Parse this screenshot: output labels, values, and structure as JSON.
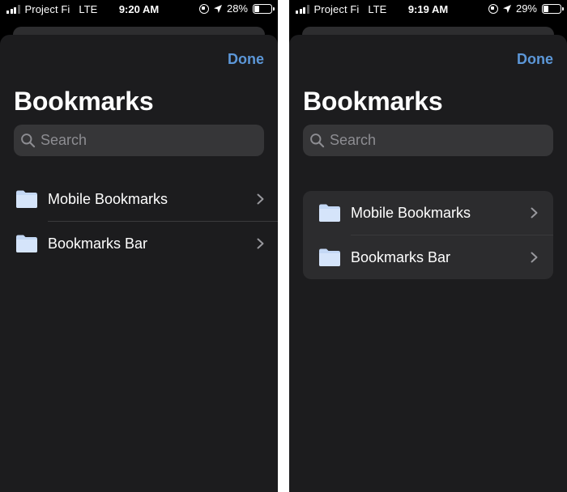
{
  "screens": [
    {
      "status_bar": {
        "carrier": "Project Fi",
        "network": "LTE",
        "time": "9:20 AM",
        "battery": "28%",
        "battery_level": 0.28
      },
      "done_label": "Done",
      "title": "Bookmarks",
      "search": {
        "placeholder": "Search",
        "value": ""
      },
      "folders": [
        {
          "label": "Mobile Bookmarks",
          "icon": "folder-icon"
        },
        {
          "label": "Bookmarks Bar",
          "icon": "folder-icon"
        }
      ]
    },
    {
      "status_bar": {
        "carrier": "Project Fi",
        "network": "LTE",
        "time": "9:19 AM",
        "battery": "29%",
        "battery_level": 0.29
      },
      "done_label": "Done",
      "title": "Bookmarks",
      "search": {
        "placeholder": "Search",
        "value": ""
      },
      "folders": [
        {
          "label": "Mobile Bookmarks",
          "icon": "folder-icon"
        },
        {
          "label": "Bookmarks Bar",
          "icon": "folder-icon"
        }
      ]
    }
  ],
  "colors": {
    "accent": "#5c97d8",
    "sheet_background": "#1c1c1e",
    "grouped_background": "#2c2c2e",
    "search_background": "#363638",
    "folder": "#c4d8f5"
  }
}
